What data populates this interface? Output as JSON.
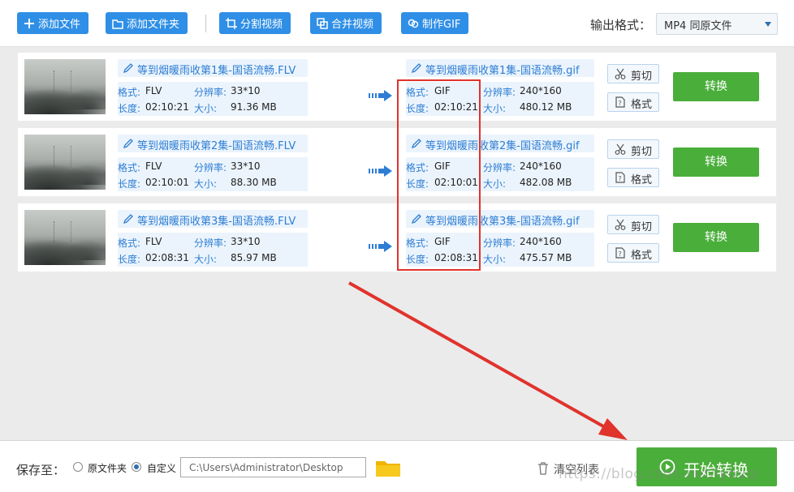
{
  "toolbar": {
    "add_file": "添加文件",
    "add_folder": "添加文件夹",
    "split_video": "分割视频",
    "merge_video": "合并视频",
    "make_gif": "制作GIF",
    "output_format_label": "输出格式：",
    "output_format_value": "MP4  同原文件"
  },
  "labels": {
    "format": "格式:",
    "resolution": "分辨率:",
    "duration": "长度:",
    "size": "大小:",
    "cut": "剪切",
    "format_btn": "格式",
    "convert": "转换"
  },
  "rows": [
    {
      "src_name": "等到烟暖雨收第1集-国语流畅.FLV",
      "src_format": "FLV",
      "src_resolution": "33*10",
      "src_duration": "02:10:21",
      "src_size": "91.36 MB",
      "dst_name": "等到烟暖雨收第1集-国语流畅.gif",
      "dst_format": "GIF",
      "dst_resolution": "240*160",
      "dst_duration": "02:10:21",
      "dst_size": "480.12 MB"
    },
    {
      "src_name": "等到烟暖雨收第2集-国语流畅.FLV",
      "src_format": "FLV",
      "src_resolution": "33*10",
      "src_duration": "02:10:01",
      "src_size": "88.30 MB",
      "dst_name": "等到烟暖雨收第2集-国语流畅.gif",
      "dst_format": "GIF",
      "dst_resolution": "240*160",
      "dst_duration": "02:10:01",
      "dst_size": "482.08 MB"
    },
    {
      "src_name": "等到烟暖雨收第3集-国语流畅.FLV",
      "src_format": "FLV",
      "src_resolution": "33*10",
      "src_duration": "02:08:31",
      "src_size": "85.97 MB",
      "dst_name": "等到烟暖雨收第3集-国语流畅.gif",
      "dst_format": "GIF",
      "dst_resolution": "240*160",
      "dst_duration": "02:08:31",
      "dst_size": "475.57 MB"
    }
  ],
  "bottom": {
    "save_to": "保存至：",
    "original_folder": "原文件夹",
    "custom": "自定义",
    "path": "C:\\Users\\Administrator\\Desktop",
    "clear_list": "清空列表",
    "start_convert": "开始转换",
    "watermark": "https://blog.csdn.net/lybyqi"
  },
  "colors": {
    "primary_blue": "#2f8fe6",
    "convert_green": "#4aae3a",
    "annotation_red": "#e0332c"
  }
}
